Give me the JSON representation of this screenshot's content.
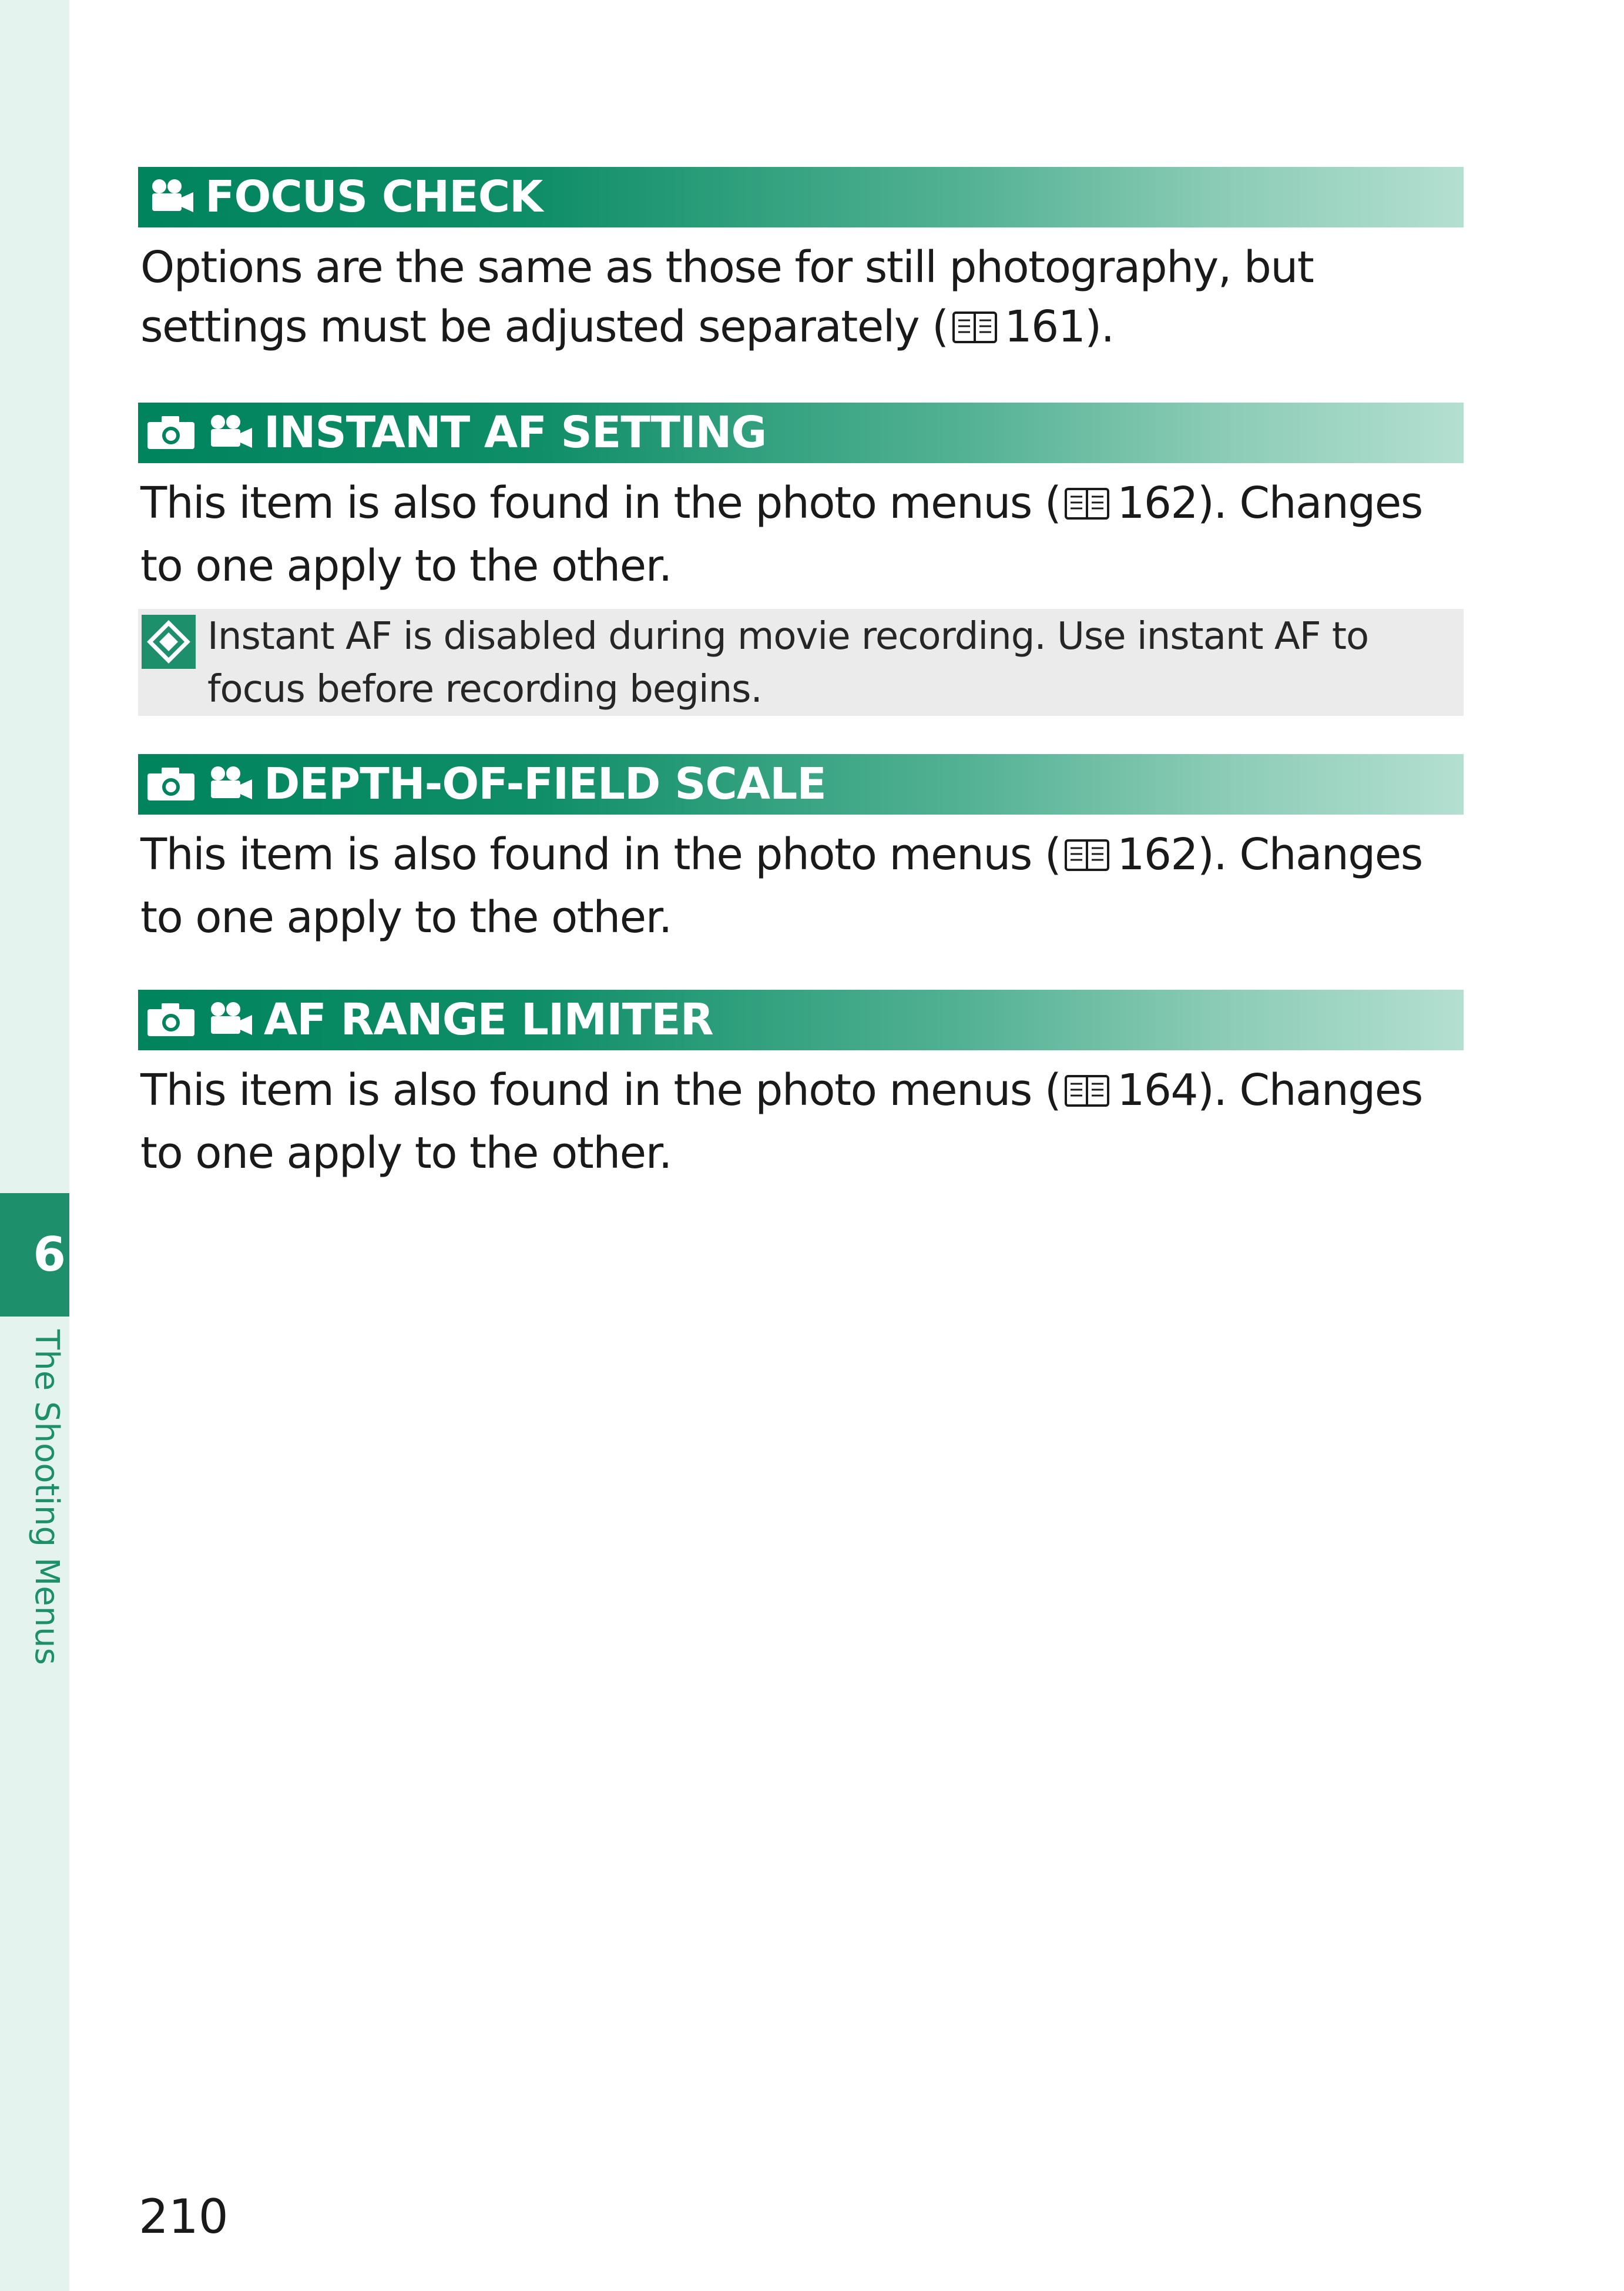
{
  "sidebar": {
    "chapter_number": "6",
    "chapter_title": "The Shooting Menus"
  },
  "sections": [
    {
      "heading": "FOCUS CHECK",
      "icons": [
        "movie-camera-icon"
      ],
      "body_before": "Options are the same as those for still photography, but settings must be adjusted separately (",
      "page_ref": "161",
      "body_after": ")."
    },
    {
      "heading": "INSTANT AF SETTING",
      "icons": [
        "still-camera-icon",
        "movie-camera-icon"
      ],
      "body_before": "This item is also found in the photo menus (",
      "page_ref": "162",
      "body_after": "). Changes to one apply to the other.",
      "note": "Instant AF is disabled during movie recording. Use instant AF to focus before recording begins."
    },
    {
      "heading": "DEPTH-OF-FIELD SCALE",
      "icons": [
        "still-camera-icon",
        "movie-camera-icon"
      ],
      "body_before": "This item is also found in the photo menus (",
      "page_ref": "162",
      "body_after": "). Changes to one apply to the other."
    },
    {
      "heading": "AF RANGE LIMITER",
      "icons": [
        "still-camera-icon",
        "movie-camera-icon"
      ],
      "body_before": "This item is also found in the photo menus (",
      "page_ref": "164",
      "body_after": "). Changes to one apply to the other."
    }
  ],
  "page_number": "210",
  "colors": {
    "heading_green": "#00845e",
    "sidebar_tint": "#e4f3ee",
    "note_background": "#ebebeb"
  }
}
